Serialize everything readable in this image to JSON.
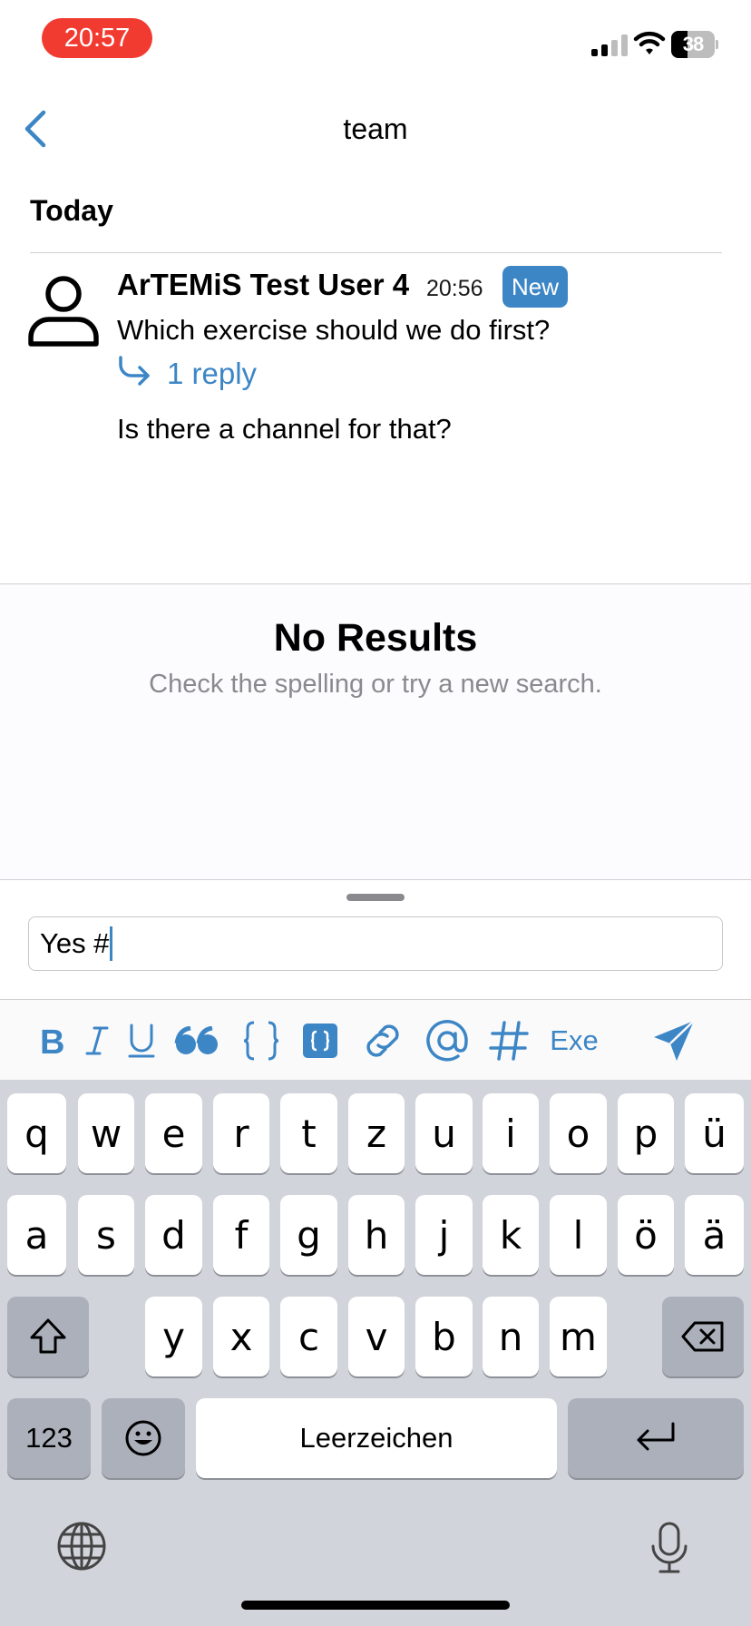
{
  "status_bar": {
    "time": "20:57",
    "battery_level": "38"
  },
  "nav": {
    "title": "team"
  },
  "feed": {
    "date_header": "Today",
    "message": {
      "author": "ArTEMiS Test User 4",
      "time": "20:56",
      "badge": "New",
      "text": "Which exercise should we do first?",
      "reply_count": "1 reply",
      "preview": "Is there a channel for that?"
    }
  },
  "search": {
    "title": "No Results",
    "subtitle": "Check the spelling or try a new search."
  },
  "composer": {
    "value": "Yes #"
  },
  "toolbar": {
    "exercise_label": "Exe"
  },
  "keyboard": {
    "row1": [
      "q",
      "w",
      "e",
      "r",
      "t",
      "z",
      "u",
      "i",
      "o",
      "p",
      "ü"
    ],
    "row2": [
      "a",
      "s",
      "d",
      "f",
      "g",
      "h",
      "j",
      "k",
      "l",
      "ö",
      "ä"
    ],
    "row3": [
      "y",
      "x",
      "c",
      "v",
      "b",
      "n",
      "m"
    ],
    "numbers_label": "123",
    "space_label": "Leerzeichen"
  }
}
